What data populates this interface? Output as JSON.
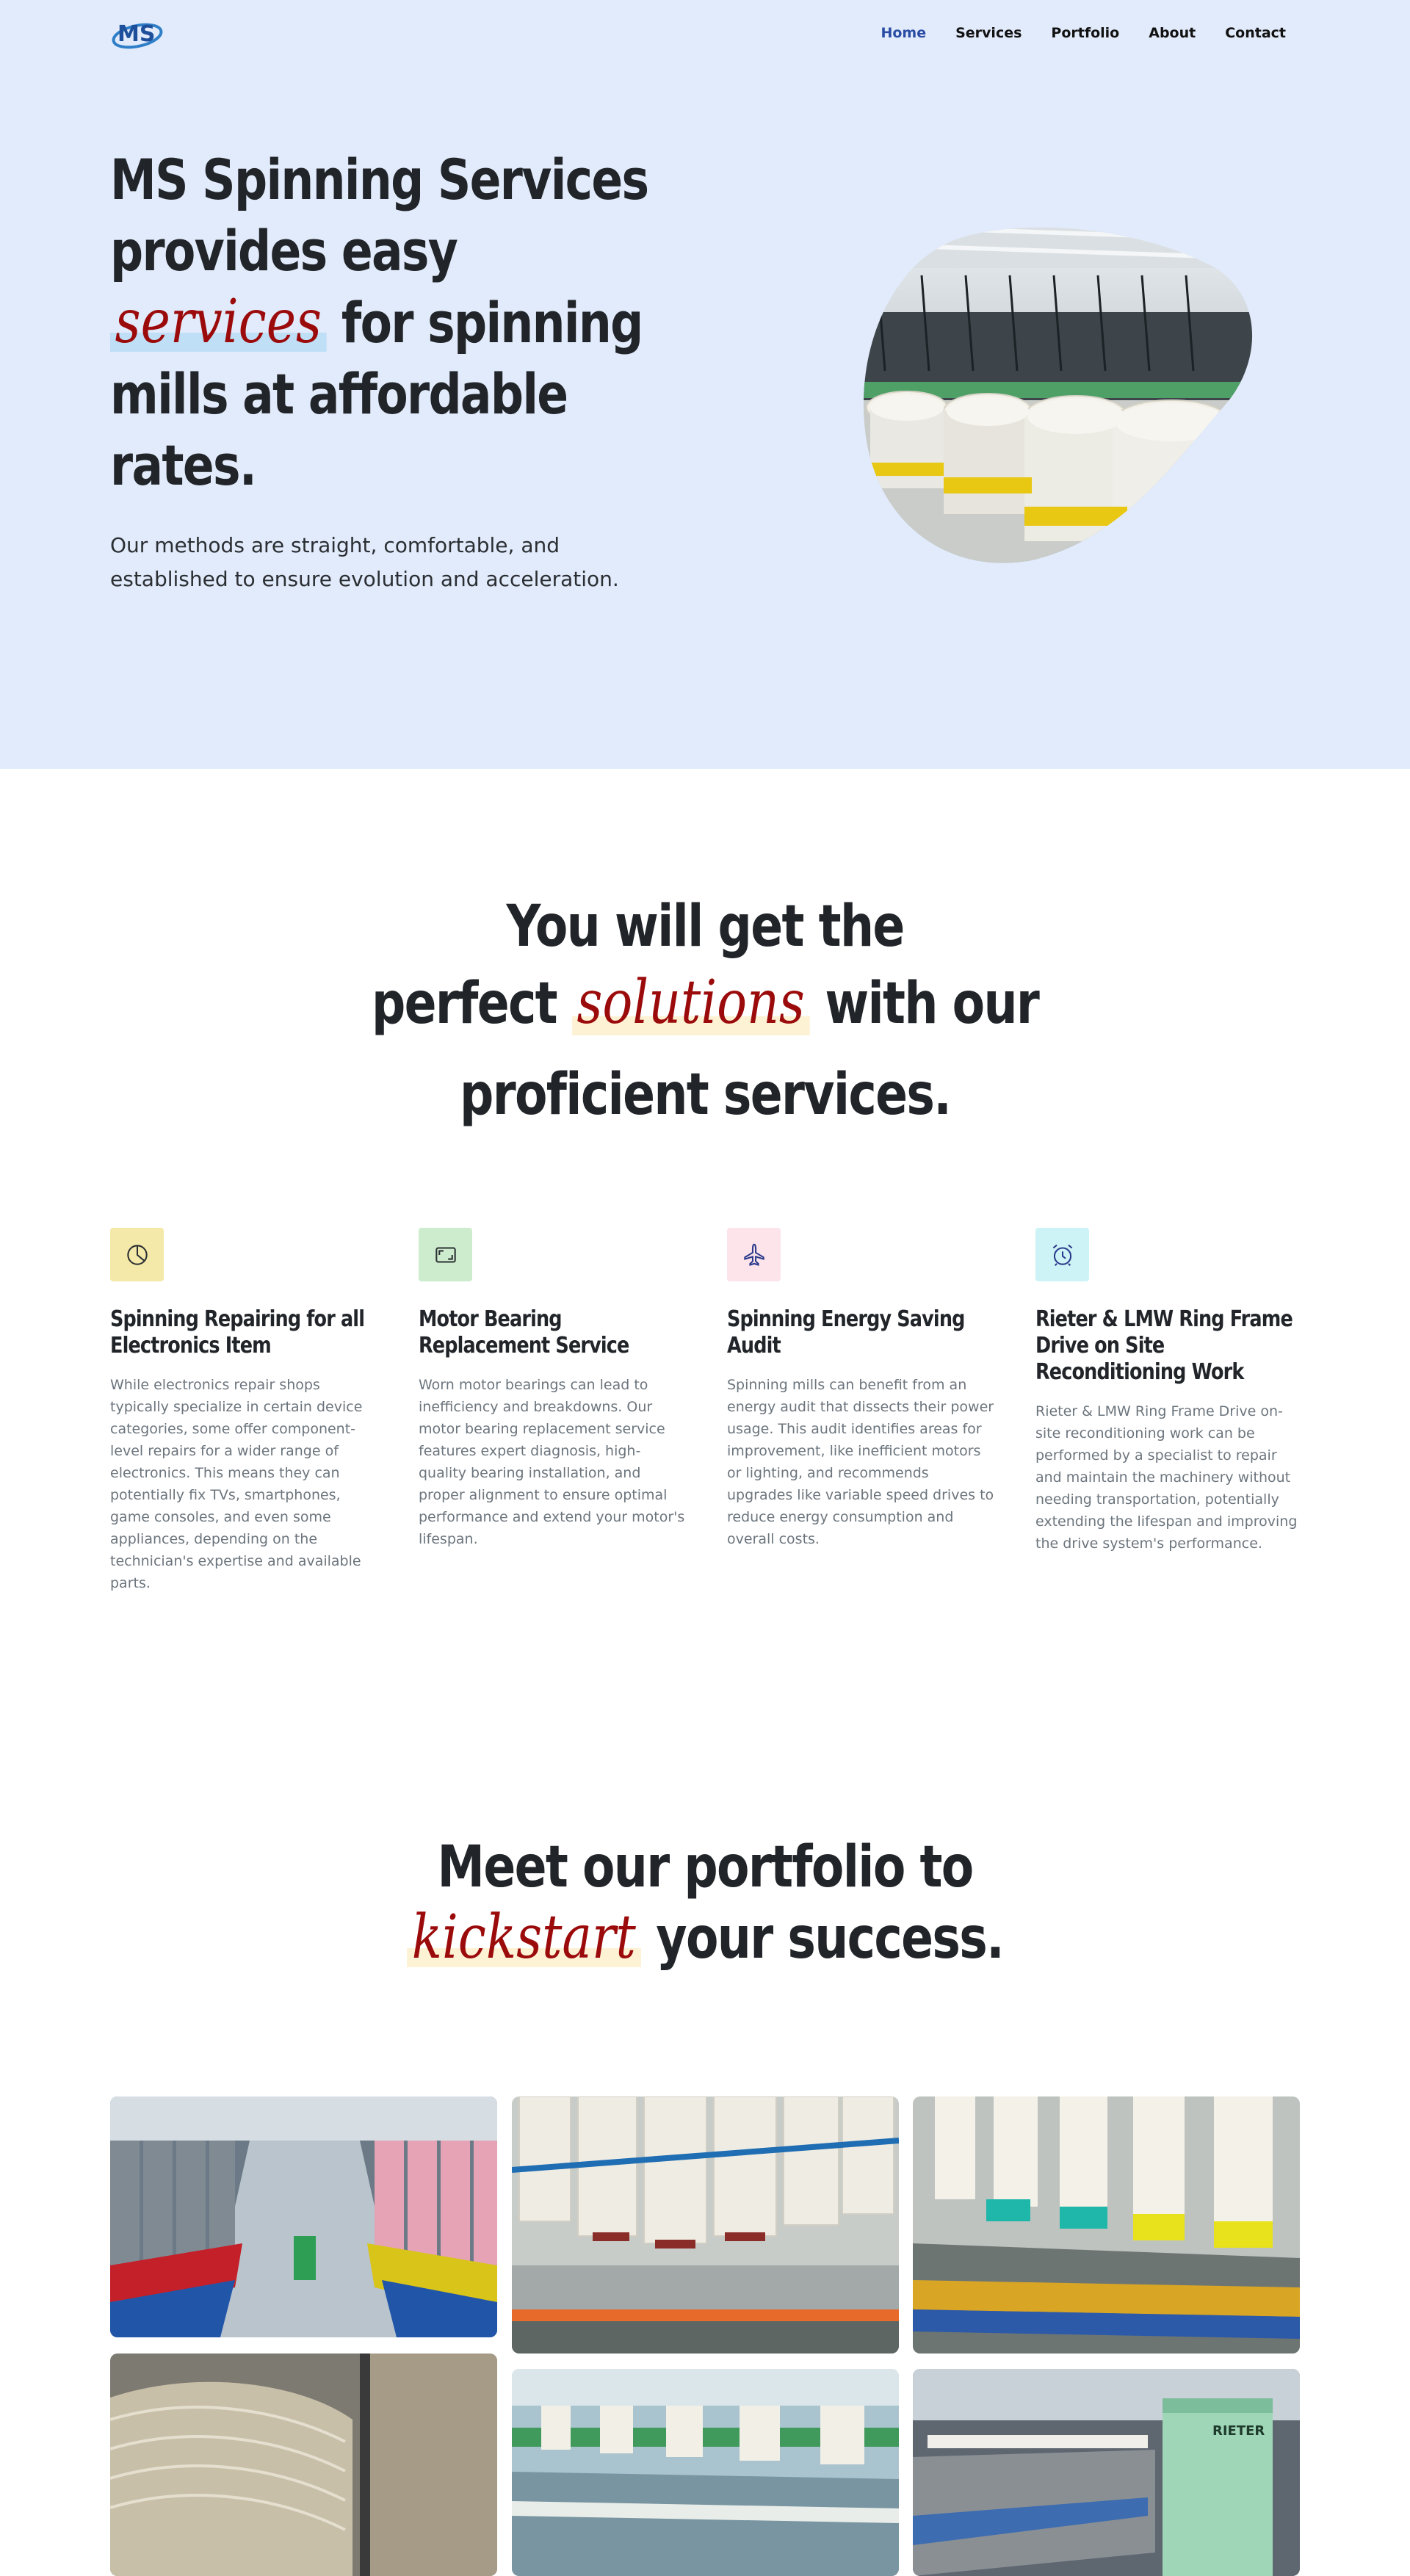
{
  "nav": {
    "logo_text": "MS",
    "items": [
      {
        "label": "Home",
        "active": true
      },
      {
        "label": "Services",
        "active": false
      },
      {
        "label": "Portfolio",
        "active": false
      },
      {
        "label": "About",
        "active": false
      },
      {
        "label": "Contact",
        "active": false
      }
    ]
  },
  "hero": {
    "title_line1": "MS Spinning Services",
    "title_line2": "provides easy",
    "title_highlight": "services",
    "title_line3_rest": " for spinning",
    "title_line4": "mills at affordable",
    "title_line5": "rates.",
    "subtitle": "Our methods are straight, comfortable, and established to ensure evolution and acceleration."
  },
  "solutions": {
    "title_line1": "You will get the",
    "title_line2_pre": "perfect ",
    "title_highlight": "solutions",
    "title_line2_post": " with our",
    "title_line3": "proficient services.",
    "items": [
      {
        "icon": "pie-chart-icon",
        "icon_bg": "#f5e9a9",
        "title": "Spinning Repairing for all Electronics Item",
        "text": "While electronics repair shops typically specialize in certain device categories, some offer component-level repairs for a wider range of electronics. This means they can potentially fix TVs, smartphones, game consoles, and even some appliances, depending on the technician's expertise and available parts."
      },
      {
        "icon": "card-icon",
        "icon_bg": "#cdeccd",
        "title": "Motor Bearing Replacement Service",
        "text": "Worn motor bearings can lead to inefficiency and breakdowns. Our motor bearing replacement service features expert diagnosis, high-quality bearing installation, and proper alignment to ensure optimal performance and extend your motor's lifespan."
      },
      {
        "icon": "airplane-icon",
        "icon_bg": "#fde3ea",
        "title": "Spinning Energy Saving Audit",
        "text": "Spinning mills can benefit from an energy audit that dissects their power usage. This audit identifies areas for improvement, like inefficient motors or lighting, and recommends upgrades like variable speed drives to reduce energy consumption and overall costs."
      },
      {
        "icon": "alarm-clock-icon",
        "icon_bg": "#cdf3f6",
        "title": "Rieter & LMW Ring Frame Drive on Site Reconditioning Work",
        "text": "Rieter & LMW Ring Frame Drive on-site reconditioning work can be performed by a specialist to repair and maintain the machinery without needing transportation, potentially extending the lifespan and improving the drive system's performance."
      }
    ]
  },
  "portfolio": {
    "title_line1": "Meet our portfolio to",
    "title_highlight": "kickstart",
    "title_line2_post": " your success."
  },
  "colors": {
    "hero_bg": "#e2ebfb",
    "nav_active": "#2a4ca4",
    "script_red": "#9b0b0b",
    "highlight_blue": "#bfdff6",
    "highlight_yellow": "#fdf2d4"
  }
}
